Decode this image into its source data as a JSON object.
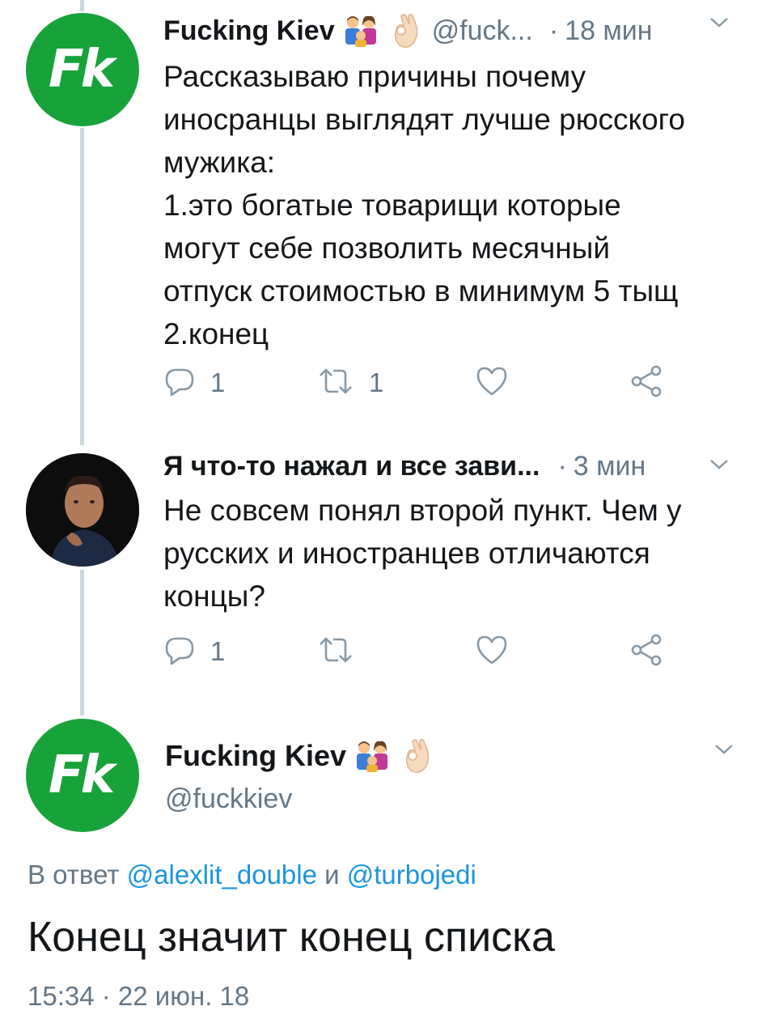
{
  "tweet1": {
    "avatar_text": "Fk",
    "name": "Fucking Kiev",
    "handle": "@fuck...",
    "dot": "·",
    "time": "18 мин",
    "lines": [
      "Рассказываю причины почему",
      "иносранцы выглядят лучше рюсского",
      "мужика:",
      "1.это богатые товарищи которые",
      "могут себе позволить месячный",
      "отпуск стоимостью в минимум 5 тыщ",
      "2.конец"
    ],
    "reply_count": "1",
    "retweet_count": "1"
  },
  "tweet2": {
    "name": "Я что-то нажал и все зави...",
    "dot": "·",
    "time": "3 мин",
    "lines": [
      "Не совсем понял второй пункт. Чем у",
      "русских и иностранцев отличаются",
      "концы?"
    ],
    "reply_count": "1"
  },
  "focus": {
    "avatar_text": "Fk",
    "name": "Fucking Kiev",
    "handle": "@fuckkiev",
    "reply_prefix": "В ответ",
    "reply_user1": "@alexlit_double",
    "reply_and": "и",
    "reply_user2": "@turbojedi",
    "text": "Конец значит конец списка",
    "timestamp": "15:34 · 22 июн. 18"
  },
  "colors": {
    "brand_green": "#18a33a",
    "link_blue": "#1b95e0",
    "secondary_gray": "#657786",
    "thread_line": "#ccd6dd"
  },
  "icons": [
    "family-emoji-icon",
    "ok-hand-emoji-icon",
    "chevron-down-icon",
    "reply-icon",
    "retweet-icon",
    "like-icon",
    "share-icon"
  ]
}
